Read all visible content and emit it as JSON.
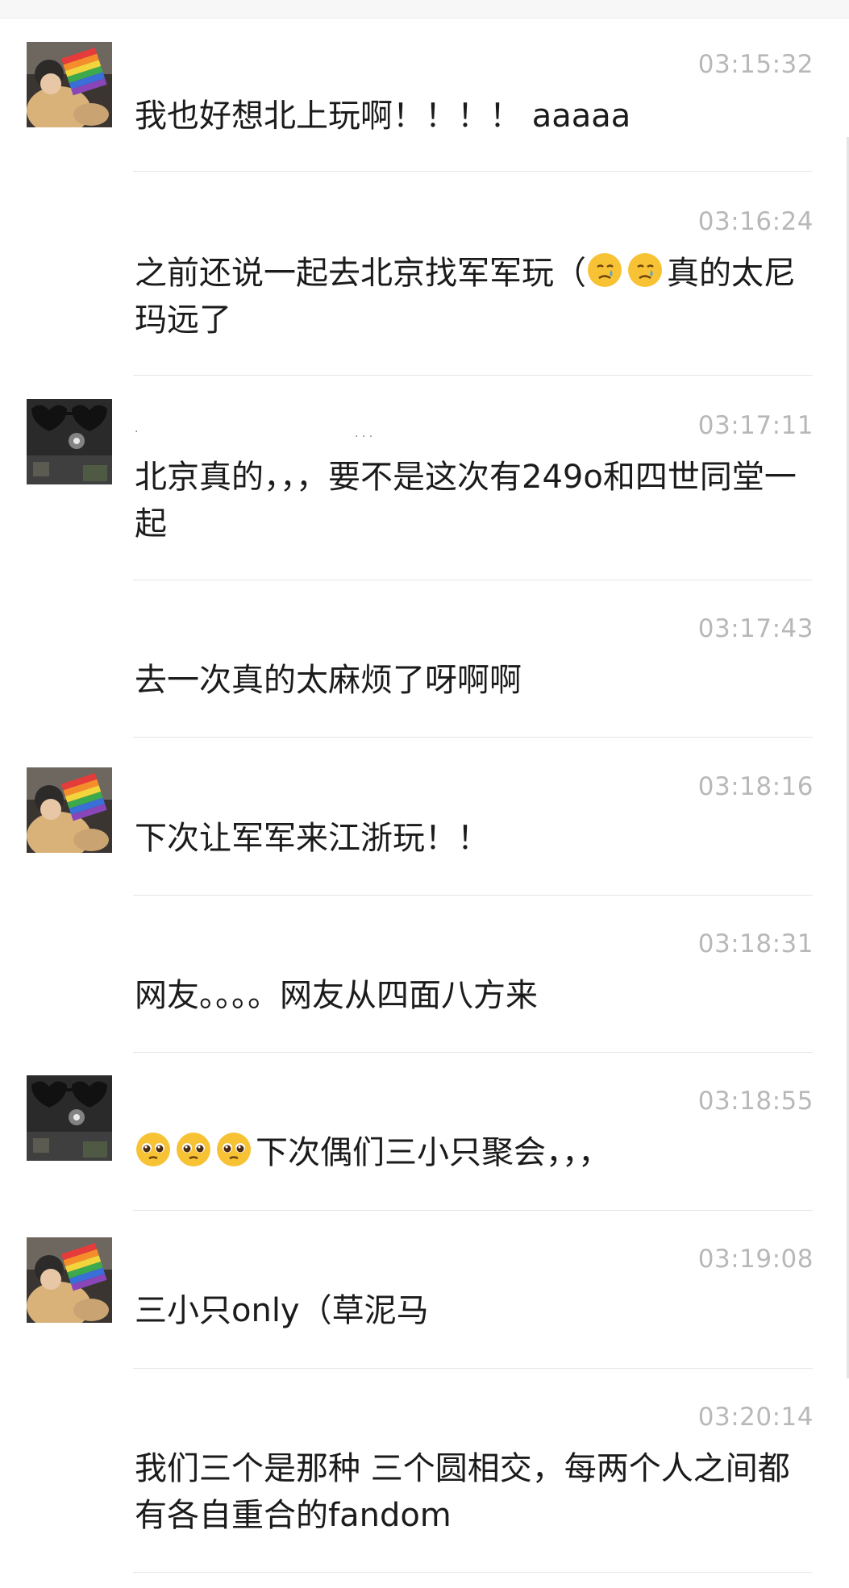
{
  "messages": [
    {
      "sender": "rainbow",
      "time": "03:15:32",
      "text": "我也好想北上玩啊！！！！ aaaaa"
    },
    {
      "sender": "rainbow",
      "time": "03:16:24",
      "text_before": "之前还说一起去北京找军军玩（",
      "emoji": [
        "crying-face-icon",
        "crying-face-icon"
      ],
      "text_after": "真的太尼玛远了"
    },
    {
      "sender": "glasses",
      "time": "03:17:11",
      "text": "北京真的，，，要不是这次有249o和四世同堂一起"
    },
    {
      "sender": "glasses",
      "time": "03:17:43",
      "text": "去一次真的太麻烦了呀啊啊"
    },
    {
      "sender": "rainbow",
      "time": "03:18:16",
      "text": "下次让军军来江浙玩！！"
    },
    {
      "sender": "rainbow",
      "time": "03:18:31",
      "text": "网友。。。。网友从四面八方来"
    },
    {
      "sender": "glasses",
      "time": "03:18:55",
      "emoji": [
        "pleading-face-icon",
        "pleading-face-icon",
        "pleading-face-icon"
      ],
      "text_after": "下次偶们三小只聚会，，，"
    },
    {
      "sender": "rainbow",
      "time": "03:19:08",
      "text": "三小只only（草泥马"
    },
    {
      "sender": "rainbow",
      "time": "03:20:14",
      "text": "我们三个是那种 三个圆相交，每两个人之间都有各自重合的fandom"
    }
  ],
  "avatars": {
    "rainbow": "rainbow-flag-avatar",
    "glasses": "heart-sunglasses-avatar"
  },
  "colors": {
    "timestamp": "#b8b8b8",
    "text": "#1b1b1b",
    "divider": "#e6e6e6"
  }
}
